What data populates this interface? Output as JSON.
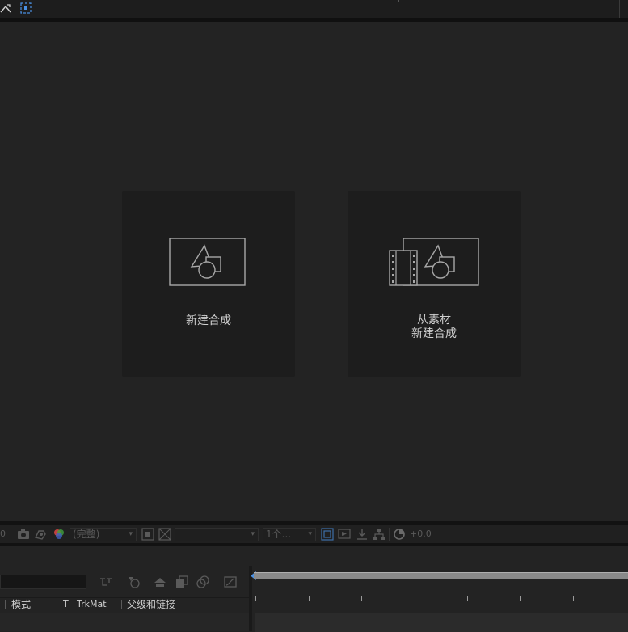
{
  "new_composition": {
    "label": "新建合成"
  },
  "from_footage": {
    "line1": "从素材",
    "line2": "新建合成"
  },
  "viewer_toolbar": {
    "resolution": "(完整)",
    "views": "1个...",
    "exposure": "+0.0"
  },
  "timeline": {
    "columns": {
      "mode": "模式",
      "t": "T",
      "trkmat": "TrkMat",
      "parent": "父级和链接"
    }
  },
  "colors": {
    "accent": "#4a90e2",
    "card": "#1d1d1d",
    "background": "#232323"
  }
}
